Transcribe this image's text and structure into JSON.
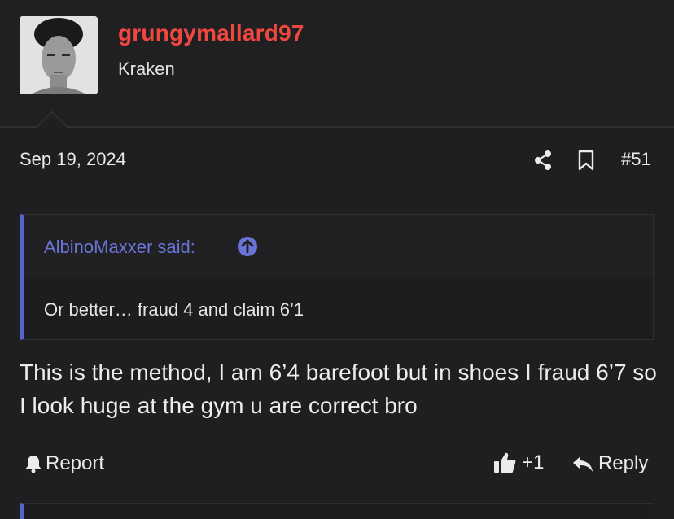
{
  "user": {
    "username": "grungymallard97",
    "title": "Kraken"
  },
  "post": {
    "date": "Sep 19, 2024",
    "number": "#51",
    "quote": {
      "author_line": "AlbinoMaxxer said:",
      "text": "Or better… fraud 4 and claim 6’1"
    },
    "message": "This is the method, I am 6’4 barefoot but in shoes I fraud 6’7 so I look huge at the gym u are correct bro"
  },
  "actions": {
    "report_label": "Report",
    "like_count": "+1",
    "reply_label": "Reply"
  },
  "colors": {
    "username": "#f0473e",
    "quote_accent": "#5a63c9",
    "background": "#1f1f21"
  }
}
